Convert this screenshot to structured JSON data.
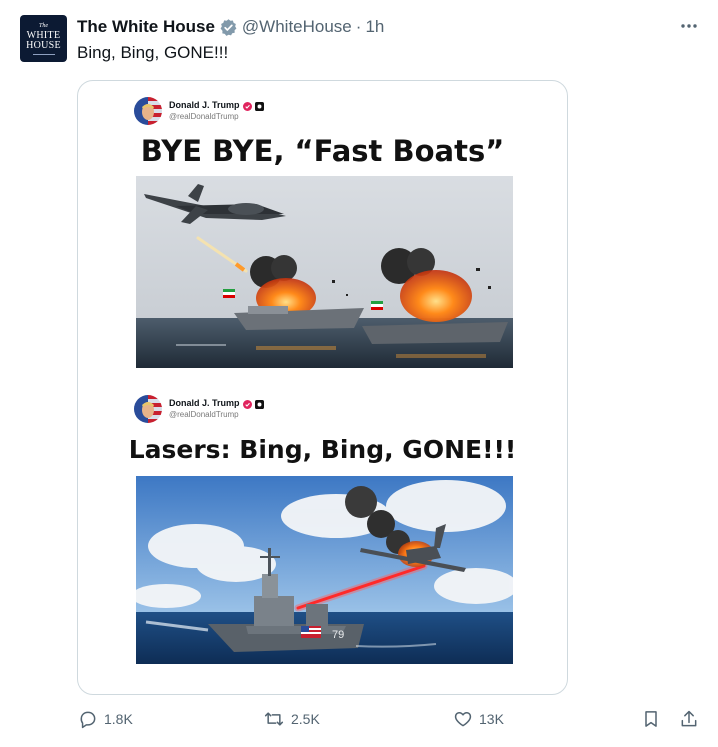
{
  "account": {
    "name": "The White House",
    "handle": "@WhiteHouse",
    "separator": "·",
    "time": "1h",
    "avatar_lines": [
      "The",
      "WHITE",
      "HOUSE"
    ]
  },
  "tweet": {
    "text": "Bing, Bing, GONE!!!"
  },
  "media": {
    "post1": {
      "author": "Donald J. Trump",
      "handle": "@realDonaldTrump",
      "headline": "BYE BYE, “Fast Boats”"
    },
    "post2": {
      "author": "Donald J. Trump",
      "handle": "@realDonaldTrump",
      "headline": "Lasers: Bing, Bing, GONE!!!"
    },
    "ship_hull_number": "79"
  },
  "actions": {
    "replies": "1.8K",
    "reposts": "2.5K",
    "likes": "13K"
  },
  "colors": {
    "verified": "#1d9bf0",
    "muted_text": "#536471",
    "laser": "#ff2a2a"
  },
  "icons": [
    "verified-badge-icon",
    "more-icon",
    "reply-icon",
    "repost-icon",
    "like-icon",
    "bookmark-icon",
    "share-icon"
  ]
}
